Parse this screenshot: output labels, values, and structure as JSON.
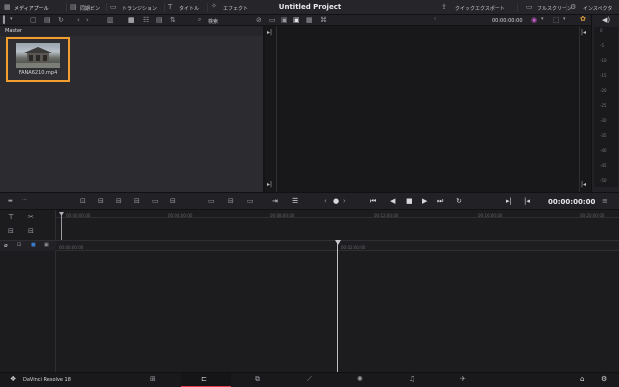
{
  "topbar": {
    "tabs": [
      {
        "label": "メディアプール"
      },
      {
        "label": "同期ビン"
      },
      {
        "label": "トランジション"
      },
      {
        "label": "タイトル"
      },
      {
        "label": "エフェクト"
      }
    ],
    "project_title": "Untitled Project",
    "right_tabs": [
      {
        "label": "クイックエクスポート"
      },
      {
        "label": "フルスクリーン"
      },
      {
        "label": "インスペクタ"
      }
    ]
  },
  "toolbar": {
    "search_label": "検索",
    "timecode": "00:00:00:00"
  },
  "media_pool": {
    "bin_label": "Master",
    "clip_name": "FANA6210.mp4"
  },
  "meter": {
    "scale": [
      "0",
      "-5",
      "-10",
      "-15",
      "-20",
      "-25",
      "-30",
      "-35",
      "-40",
      "-45",
      "-50"
    ]
  },
  "transport": {
    "timecode": "00:00:00:00"
  },
  "ruler_top": [
    "00:00:00:00",
    "00:04:00:00",
    "00:08:00:00",
    "00:12:00:00",
    "00:16:00:00",
    "00:20:00:00"
  ],
  "ruler_bottom": [
    "00:00:00:00",
    "00:02:00:00"
  ],
  "footer": {
    "app_name": "DaVinci Resolve 18"
  },
  "colors": {
    "accent_orange": "#f29e2e",
    "accent_red": "#e03b47",
    "bg": "#1c1c1f"
  }
}
